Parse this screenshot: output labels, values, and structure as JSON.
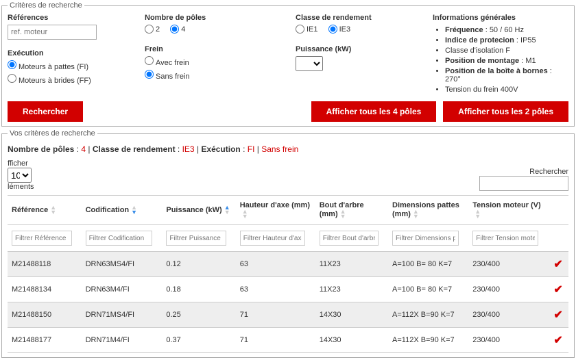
{
  "criteria": {
    "legend": "Critères de recherche",
    "references_label": "Références",
    "references_placeholder": "ref. moteur",
    "execution_label": "Exécution",
    "execution_opts": [
      "Moteurs à pattes (FI)",
      "Moteurs à brides (FF)"
    ],
    "poles_label": "Nombre de pôles",
    "poles_opts": [
      "2",
      "4"
    ],
    "frein_label": "Frein",
    "frein_opts": [
      "Avec frein",
      "Sans frein"
    ],
    "classe_label": "Classe de rendement",
    "classe_opts": [
      "IE1",
      "IE3"
    ],
    "puissance_label": "Puissance (kW)",
    "info_header": "Informations générales",
    "info_items": [
      {
        "label": "Fréquence",
        "value": "50 / 60 Hz"
      },
      {
        "label": "Indice de protecion",
        "value": "IP55"
      },
      {
        "label": "Classe d'isolation F",
        "value": ""
      },
      {
        "label": "Position de montage",
        "value": "M1"
      },
      {
        "label": "Position de la boîte à bornes",
        "value": "270°"
      },
      {
        "label": "Tension du frein 400V",
        "value": ""
      }
    ],
    "btn_search": "Rechercher",
    "btn_show4": "Afficher tous les 4 pôles",
    "btn_show2": "Afficher tous les 2 pôles"
  },
  "your_criteria": {
    "legend": "Vos critères de recherche",
    "summary": {
      "poles_label": "Nombre de pôles",
      "poles_value": "4",
      "classe_label": "Classe de rendement",
      "classe_value": "IE3",
      "execution_label": "Exécution",
      "execution_value": "FI",
      "frein_value": "Sans frein"
    }
  },
  "table_controls": {
    "afficher_label": "fficher",
    "afficher_value": "10",
    "elements_label": "léments",
    "rechercher_label": "Rechercher"
  },
  "columns": [
    {
      "label": "Référence",
      "filter": "Filtrer Référence"
    },
    {
      "label": "Codification",
      "filter": "Filtrer Codification"
    },
    {
      "label": "Puissance (kW)",
      "filter": "Filtrer Puissance (kW)"
    },
    {
      "label": "Hauteur d'axe (mm)",
      "filter": "Filtrer Hauteur d'axe (mm)"
    },
    {
      "label": "Bout d'arbre (mm)",
      "filter": "Filtrer Bout d'arbre (mm)"
    },
    {
      "label": "Dimensions pattes (mm)",
      "filter": "Filtrer Dimensions pattes"
    },
    {
      "label": "Tension moteur (V)",
      "filter": "Filtrer Tension moteur"
    }
  ],
  "rows": [
    {
      "ref": "M21488118",
      "cod": "DRN63MS4/FI",
      "pui": "0.12",
      "hau": "63",
      "bou": "11X23",
      "dim": "A=100 B= 80 K=7",
      "ten": "230/400"
    },
    {
      "ref": "M21488134",
      "cod": "DRN63M4/FI",
      "pui": "0.18",
      "hau": "63",
      "bou": "11X23",
      "dim": "A=100 B= 80 K=7",
      "ten": "230/400"
    },
    {
      "ref": "M21488150",
      "cod": "DRN71MS4/FI",
      "pui": "0.25",
      "hau": "71",
      "bou": "14X30",
      "dim": "A=112X B=90 K=7",
      "ten": "230/400"
    },
    {
      "ref": "M21488177",
      "cod": "DRN71M4/FI",
      "pui": "0.37",
      "hau": "71",
      "bou": "14X30",
      "dim": "A=112X B=90 K=7",
      "ten": "230/400"
    }
  ]
}
